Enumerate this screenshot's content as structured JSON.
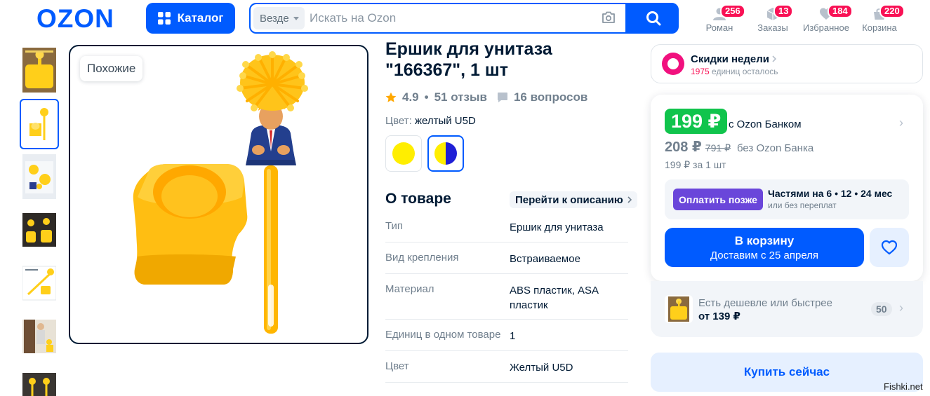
{
  "header": {
    "logo_text": "OZON",
    "catalog_label": "Каталог",
    "search_scope": "Везде",
    "search_placeholder": "Искать на Ozon",
    "nav": [
      {
        "label": "Роман",
        "badge": "256",
        "icon": "user-icon"
      },
      {
        "label": "Заказы",
        "badge": "13",
        "icon": "box-icon"
      },
      {
        "label": "Избранное",
        "badge": "184",
        "icon": "heart-icon"
      },
      {
        "label": "Корзина",
        "badge": "220",
        "icon": "cart-icon"
      }
    ]
  },
  "gallery": {
    "similar_label": "Похожие",
    "thumbnail_count": 7,
    "selected_index": 1
  },
  "product": {
    "title": "Ершик для унитаза \"166367\", 1 шт",
    "rating": "4.9",
    "reviews": "51 отзыв",
    "questions": "16 вопросов",
    "color_label": "Цвет:",
    "color_value": "желтый U5D",
    "about_title": "О товаре",
    "to_description": "Перейти к описанию",
    "specs": [
      {
        "key": "Тип",
        "value": "Ершик для унитаза"
      },
      {
        "key": "Вид крепления",
        "value": "Встраиваемое"
      },
      {
        "key": "Материал",
        "value": "ABS пластик, ASA пластик"
      },
      {
        "key": "Единиц в одном товаре",
        "value": "1"
      },
      {
        "key": "Цвет",
        "value": "Желтый U5D"
      }
    ]
  },
  "promo": {
    "title": "Скидки недели",
    "count": "1975",
    "sub": "единиц осталось"
  },
  "price": {
    "main": "199 ₽",
    "bank_label": "с Ozon Банком",
    "regular": "208 ₽",
    "old": "791 ₽",
    "no_bank_label": "без Ozon Банка",
    "per_unit": "199 ₽ за 1 шт",
    "pay_later": "Оплатить позже",
    "installment_title": "Частями на 6 • 12 • 24 мес",
    "installment_sub": "или без переплат",
    "cart_label": "В корзину",
    "cart_sub": "Доставим с 25 апреля"
  },
  "cheaper": {
    "title": "Есть дешевле или быстрее",
    "price": "от 139 ₽",
    "count": "50"
  },
  "buy_now_label": "Купить сейчас",
  "watermark": "Fishki.net",
  "colors": {
    "brand": "#005bff",
    "price_green": "#10c44c",
    "badge_pink": "#f91155",
    "pay_later_purple": "#6a46da",
    "product_yellow": "#ffd21a"
  }
}
